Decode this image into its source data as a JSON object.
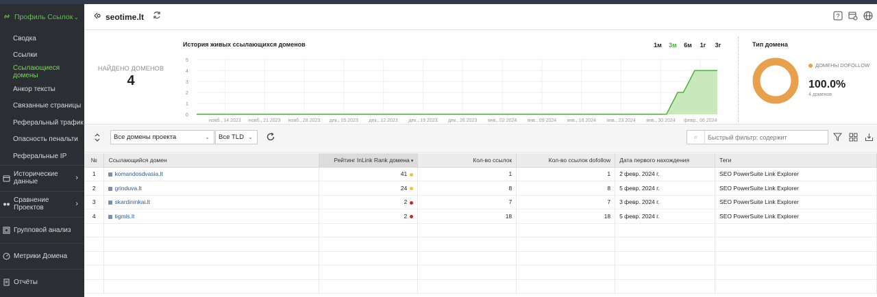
{
  "sidebar": {
    "profile_label": "Профиль Ссылок",
    "sub_items": [
      {
        "label": "Сводка"
      },
      {
        "label": "Ссылки"
      },
      {
        "label": "Ссылающиеся домены",
        "active": true
      },
      {
        "label": "Анкор тексты"
      },
      {
        "label": "Связанные страницы"
      },
      {
        "label": "Реферальный трафик"
      },
      {
        "label": "Опасность пенальти"
      },
      {
        "label": "Реферальные IP"
      }
    ],
    "sections": [
      {
        "label": "Исторические данные",
        "icon": "calendar-icon",
        "arrow": "›"
      },
      {
        "label": "Сравнение Проектов",
        "icon": "compare-icon",
        "arrow": "›"
      },
      {
        "label": "Групповой анализ",
        "icon": "group-icon"
      },
      {
        "label": "Метрики Домена",
        "icon": "metrics-icon"
      },
      {
        "label": "Отчёты",
        "icon": "report-icon"
      }
    ]
  },
  "header": {
    "title": "seotime.lt",
    "icons": [
      "help-icon",
      "calendar-settings-icon",
      "globe-icon"
    ]
  },
  "stats": {
    "found_label": "НАЙДЕНО ДОМЕНОВ",
    "found_value": "4",
    "history_title": "История живых ссылающихся доменов",
    "periods": [
      "1м",
      "3м",
      "6м",
      "1г",
      "3г"
    ],
    "active_period": "3м",
    "domain_type_title": "Тип домена",
    "legend_label": "ДОМЕНЫ DOFOLLOW",
    "percent": "100.0%",
    "percent_sub": "4 доменов",
    "dofollow_color": "#e8a04d"
  },
  "chart_data": {
    "type": "area",
    "x_tick_labels": [
      "нояб., 14 2023",
      "нояб., 21 2023",
      "нояб., 28 2023",
      "дек., 05 2023",
      "дек., 12 2023",
      "дек., 19 2023",
      "дек., 26 2023",
      "янв., 02 2024",
      "янв., 09 2024",
      "янв., 16 2024",
      "янв., 23 2024",
      "янв., 30 2024",
      "февр., 06 2024"
    ],
    "y_ticks": [
      0,
      1,
      2,
      3,
      4,
      5
    ],
    "ylim": [
      0,
      5
    ],
    "series": [
      {
        "points": [
          [
            "2023-11-09",
            0
          ],
          [
            "2024-01-31",
            0
          ],
          [
            "2024-02-02",
            2
          ],
          [
            "2024-02-03",
            2
          ],
          [
            "2024-02-05",
            4
          ],
          [
            "2024-02-09",
            4
          ]
        ]
      }
    ],
    "color": "#4caf3c",
    "fill": "#c9e8bc",
    "grid": true
  },
  "toolbar": {
    "select_domains": "Все домены проекта",
    "select_tld": "Все TLD",
    "filter_placeholder": "Быстрый фильтр: содержит"
  },
  "table": {
    "columns": [
      "№",
      "Ссылающийся домен",
      "Рейтинг InLink Rank домена",
      "Кол-во ссылок",
      "Кол-во ссылок dofollow",
      "Дата первого нахождения",
      "Теги"
    ],
    "rows": [
      {
        "n": "1",
        "domain": "komandosdvasia.lt",
        "rank": "41",
        "rank_color": "#e8c53a",
        "links": "1",
        "dofollow": "1",
        "date": "2 февр. 2024 г.",
        "tags": "SEO PowerSuite Link Explorer"
      },
      {
        "n": "2",
        "domain": "grinduva.lt",
        "rank": "24",
        "rank_color": "#e8c53a",
        "links": "8",
        "dofollow": "8",
        "date": "5 февр. 2024 г.",
        "tags": "SEO PowerSuite Link Explorer"
      },
      {
        "n": "3",
        "domain": "skardininkai.lt",
        "rank": "2",
        "rank_color": "#c62828",
        "links": "7",
        "dofollow": "7",
        "date": "3 февр. 2024 г.",
        "tags": "SEO PowerSuite Link Explorer"
      },
      {
        "n": "4",
        "domain": "tigmis.lt",
        "rank": "2",
        "rank_color": "#c62828",
        "links": "18",
        "dofollow": "18",
        "date": "5 февр. 2024 г.",
        "tags": "SEO PowerSuite Link Explorer"
      }
    ]
  }
}
